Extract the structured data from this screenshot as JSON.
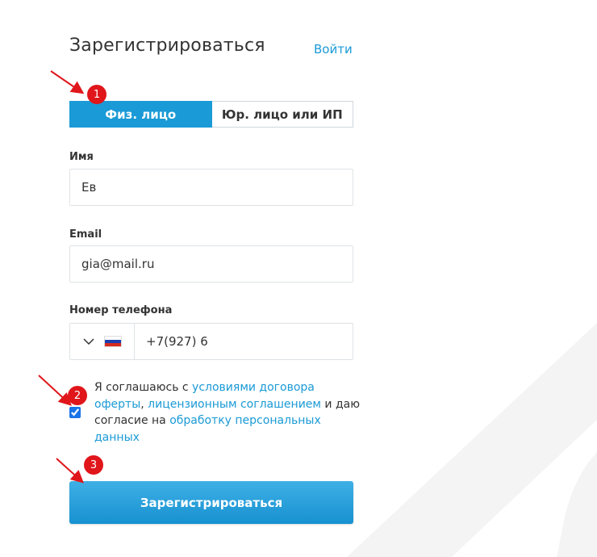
{
  "header": {
    "title": "Зарегистрироваться",
    "login_link": "Войти"
  },
  "tabs": [
    {
      "label": "Физ. лицо",
      "active": true
    },
    {
      "label": "Юр. лицо или ИП",
      "active": false
    }
  ],
  "form": {
    "name_label": "Имя",
    "name_value": "Ев",
    "email_label": "Email",
    "email_value": "gia@mail.ru",
    "phone_label": "Номер телефона",
    "phone_country": "russia-flag",
    "phone_value": "+7(927) 6"
  },
  "agreement": {
    "text_1": "Я соглашаюсь с ",
    "link_1": "условиями договора оферты",
    "text_2": ", ",
    "link_2": "лицензионным соглашением",
    "text_3": " и даю согласие на ",
    "link_3": "обработку персональных данных",
    "checked": true
  },
  "submit_label": "Зарегистрироваться",
  "markers": [
    "1",
    "2",
    "3"
  ],
  "colors": {
    "accent": "#1a9ad6",
    "marker": "#e0161b"
  }
}
